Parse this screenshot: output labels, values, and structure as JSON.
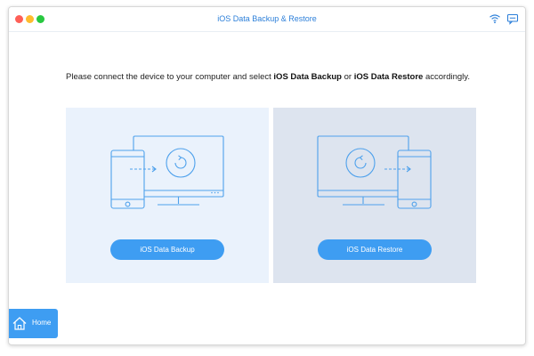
{
  "window": {
    "title": "iOS Data Backup & Restore",
    "accent_color": "#3e9df2",
    "title_color": "#2c7fd9"
  },
  "toolbar": {
    "icons": [
      "wifi-icon",
      "message-icon"
    ]
  },
  "instruction": {
    "prefix": "Please connect the device to your computer and select ",
    "option1": "iOS Data Backup",
    "middle": " or ",
    "option2": "iOS Data Restore",
    "suffix": " accordingly."
  },
  "panels": {
    "backup": {
      "button_label": "iOS Data Backup",
      "icon": "phone-to-monitor-backup-illustration",
      "background": "#eaf2fc"
    },
    "restore": {
      "button_label": "iOS Data Restore",
      "icon": "monitor-to-phone-restore-illustration",
      "background": "#dde4ef"
    }
  },
  "home": {
    "label": "Home",
    "icon": "house-icon"
  }
}
